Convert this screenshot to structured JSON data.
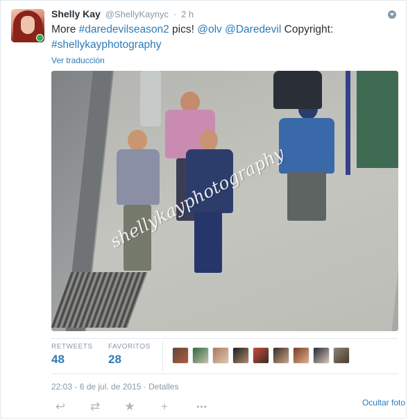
{
  "tweet": {
    "fullname": "Shelly Kay",
    "username": "@ShellyKaynyc",
    "separator": "·",
    "time": "2 h",
    "text": {
      "part1": "More ",
      "hashtag1": "#daredevilseason2",
      "part2": " pics! ",
      "mention1": "@olv",
      "space": " ",
      "mention2": "@Daredevil",
      "part3": " Copyright:",
      "hashtag2": "#shellykayphotography"
    },
    "translate_label": "Ver traducción",
    "photo_watermark": "shellykayphotography"
  },
  "stats": {
    "retweets_label": "RETWEETS",
    "retweets_value": "48",
    "favorites_label": "FAVORITOS",
    "favorites_value": "28"
  },
  "metadata": {
    "timestamp": "22:03 - 6 de jul. de 2015",
    "separator": "·",
    "details_label": "Detalles"
  },
  "actions": {
    "reply_icon": "↩",
    "retweet_icon": "⇄",
    "favorite_icon": "★",
    "follow_icon": "+",
    "more_icon": "•••",
    "hide_photo_label": "Ocultar foto"
  },
  "colors": {
    "link": "#2b7bb9",
    "muted": "#8899a6",
    "text": "#292f33",
    "border": "#e1e8ed"
  }
}
